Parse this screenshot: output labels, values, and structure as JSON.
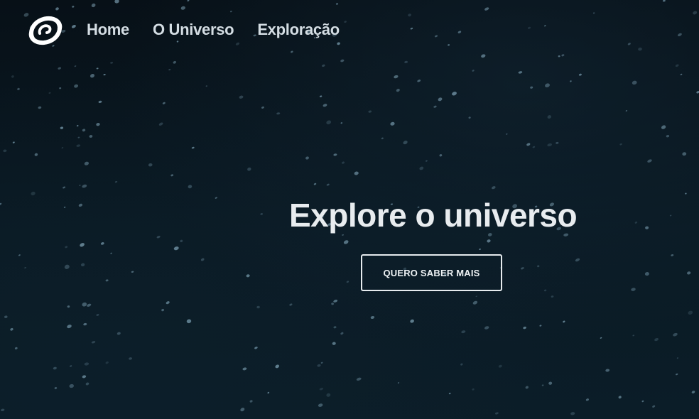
{
  "navbar": {
    "logo_icon": "swirl-galaxy-logo-icon",
    "links": [
      {
        "label": "Home"
      },
      {
        "label": "O Universo"
      },
      {
        "label": "Exploração"
      }
    ]
  },
  "hero": {
    "headline": "Explore o universo",
    "cta_label": "QUERO SABER MAIS"
  },
  "colors": {
    "background": "#06111a",
    "text": "#e8ecef",
    "nav_text": "#d4dde3",
    "star": "#7fa3b6"
  }
}
